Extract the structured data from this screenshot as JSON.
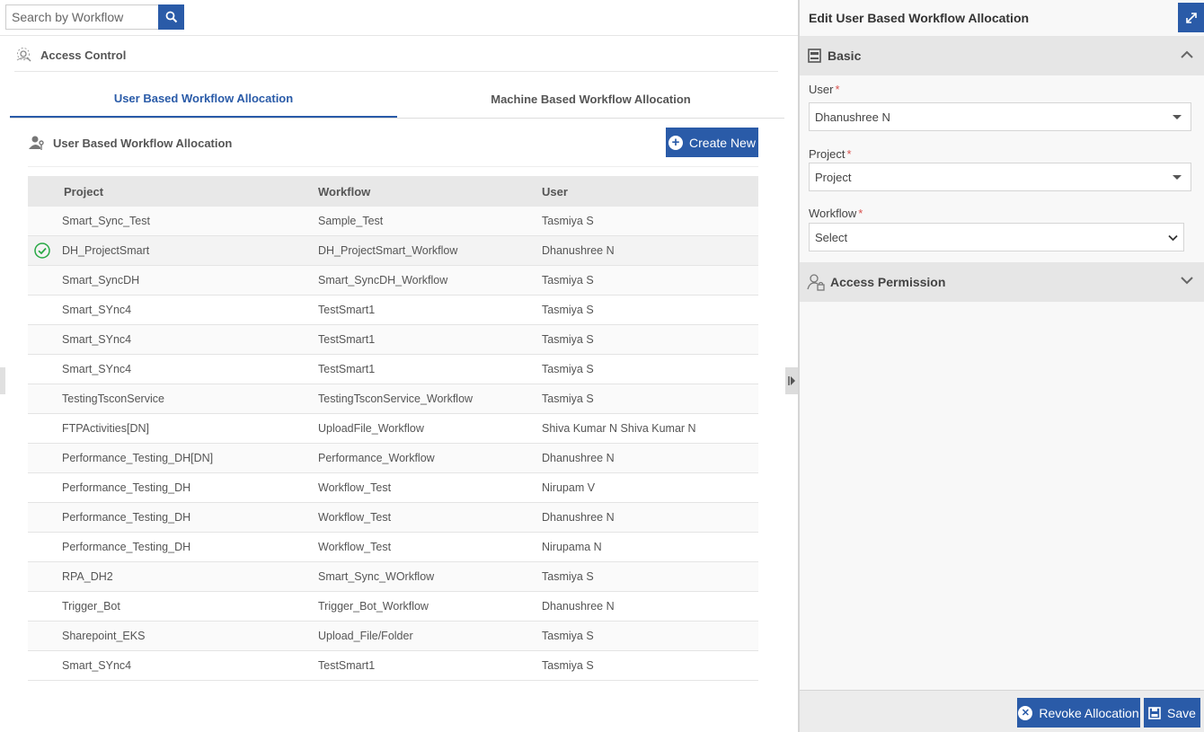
{
  "search": {
    "placeholder": "Search by Workflow"
  },
  "breadcrumb": {
    "title": "Access Control"
  },
  "tabs": [
    {
      "label": "User Based Workflow Allocation",
      "active": true
    },
    {
      "label": "Machine Based Workflow Allocation",
      "active": false
    }
  ],
  "section": {
    "title": "User Based Workflow Allocation",
    "create_label": "Create New"
  },
  "table": {
    "columns": [
      "Project",
      "Workflow",
      "User"
    ],
    "rows": [
      [
        "Smart_Sync_Test",
        "Sample_Test",
        "Tasmiya S"
      ],
      [
        "DH_ProjectSmart",
        "DH_ProjectSmart_Workflow",
        "Dhanushree N"
      ],
      [
        "Smart_SyncDH",
        "Smart_SyncDH_Workflow",
        "Tasmiya S"
      ],
      [
        "Smart_SYnc4",
        "TestSmart1",
        "Tasmiya S"
      ],
      [
        "Smart_SYnc4",
        "TestSmart1",
        "Tasmiya S"
      ],
      [
        "Smart_SYnc4",
        "TestSmart1",
        "Tasmiya S"
      ],
      [
        "TestingTsconService",
        "TestingTsconService_Workflow",
        "Tasmiya S"
      ],
      [
        "FTPActivities[DN]",
        "UploadFile_Workflow",
        "Shiva Kumar N Shiva Kumar N"
      ],
      [
        "Performance_Testing_DH[DN]",
        "Performance_Workflow",
        "Dhanushree N"
      ],
      [
        "Performance_Testing_DH",
        "Workflow_Test",
        "Nirupam V"
      ],
      [
        "Performance_Testing_DH",
        "Workflow_Test",
        "Dhanushree N"
      ],
      [
        "Performance_Testing_DH",
        "Workflow_Test",
        "Nirupama N"
      ],
      [
        "RPA_DH2",
        "Smart_Sync_WOrkflow",
        "Tasmiya S"
      ],
      [
        "Trigger_Bot",
        "Trigger_Bot_Workflow",
        "Dhanushree N"
      ],
      [
        "Sharepoint_EKS",
        "Upload_File/Folder",
        "Tasmiya S"
      ],
      [
        "Smart_SYnc4",
        "TestSmart1",
        "Tasmiya S"
      ]
    ],
    "selected_index": 1
  },
  "panel": {
    "title": "Edit User Based Workflow Allocation",
    "basic_label": "Basic",
    "user_label": "User",
    "user_value": "Dhanushree N",
    "project_label": "Project",
    "project_value": "Project",
    "workflow_label": "Workflow",
    "workflow_value": "Select",
    "required_mark": "*",
    "access_label": "Access Permission",
    "revoke_label": "Revoke Allocation",
    "save_label": "Save"
  },
  "colors": {
    "accent": "#2a5ba8",
    "success": "#27a844",
    "required": "#d9534f"
  }
}
